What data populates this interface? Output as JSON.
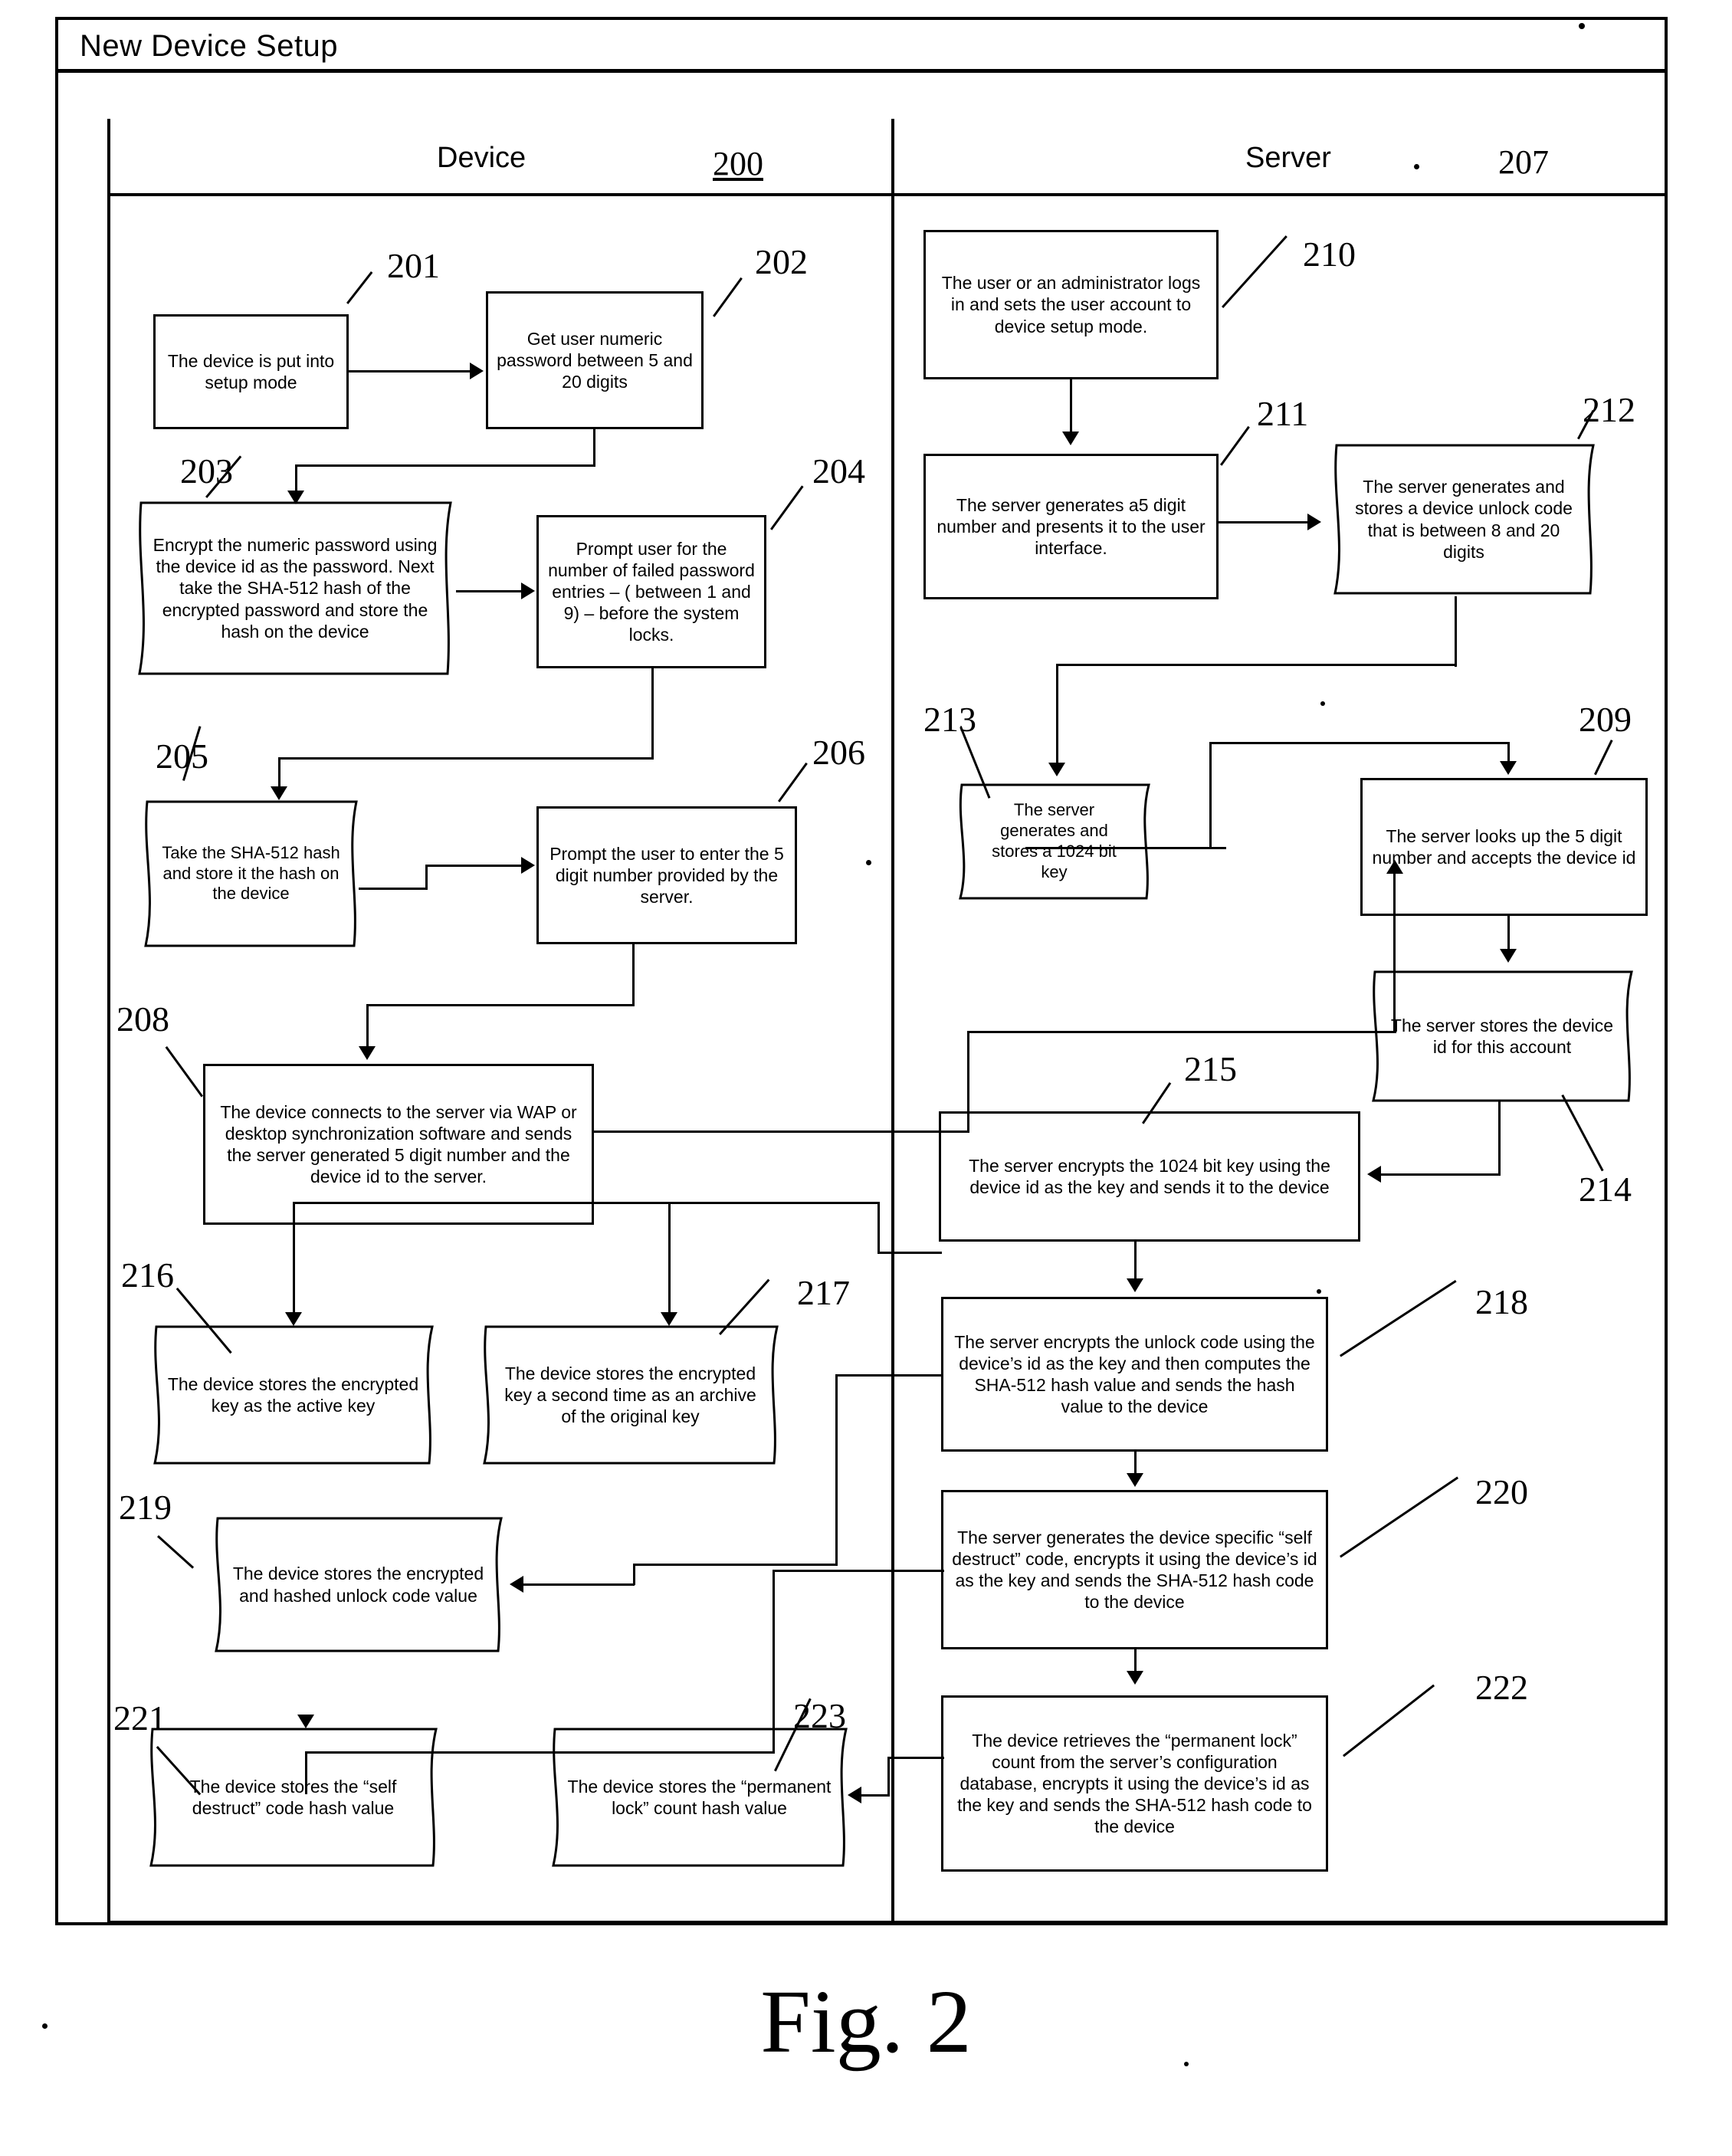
{
  "figure": {
    "caption": "Fig. 2",
    "title": "New Device Setup"
  },
  "lanes": [
    {
      "label": "Device",
      "ref": "200"
    },
    {
      "label": "Server",
      "ref": "207"
    }
  ],
  "nodes": [
    {
      "ref": "201",
      "lane": "Device",
      "shape": "process",
      "text": "The device is put into setup mode"
    },
    {
      "ref": "202",
      "lane": "Device",
      "shape": "process",
      "text": "Get user numeric password between 5 and 20 digits"
    },
    {
      "ref": "203",
      "lane": "Device",
      "shape": "document",
      "text": "Encrypt the numeric password using the device id as the password.  Next take the SHA-512 hash of the encrypted password and store the hash on the device"
    },
    {
      "ref": "204",
      "lane": "Device",
      "shape": "process",
      "text": "Prompt user for the number of failed password entries – ( between 1 and 9) – before the system locks."
    },
    {
      "ref": "205",
      "lane": "Device",
      "shape": "document",
      "text": "Take the SHA-512 hash and store it the hash on the device"
    },
    {
      "ref": "206",
      "lane": "Device",
      "shape": "process",
      "text": "Prompt the user to enter the 5 digit number provided by the server."
    },
    {
      "ref": "208",
      "lane": "Device",
      "shape": "process",
      "text": "The device connects to the server via WAP or desktop synchronization software and sends the server generated 5 digit number and the device id to the server."
    },
    {
      "ref": "216",
      "lane": "Device",
      "shape": "document",
      "text": "The device stores the encrypted key as the active key"
    },
    {
      "ref": "217",
      "lane": "Device",
      "shape": "document",
      "text": "The device stores the encrypted key a second time as an archive of the original key"
    },
    {
      "ref": "219",
      "lane": "Device",
      "shape": "document",
      "text": "The device stores the encrypted and hashed unlock code value"
    },
    {
      "ref": "221",
      "lane": "Device",
      "shape": "document",
      "text": "The device stores the “self destruct” code hash value"
    },
    {
      "ref": "223",
      "lane": "Device",
      "shape": "document",
      "text": "The device stores the “permanent lock” count hash value"
    },
    {
      "ref": "210",
      "lane": "Server",
      "shape": "process",
      "text": "The user or an administrator logs in and sets the user account to device setup mode."
    },
    {
      "ref": "211",
      "lane": "Server",
      "shape": "process",
      "text": "The server generates a5 digit number and presents it to the user interface."
    },
    {
      "ref": "212",
      "lane": "Server",
      "shape": "document",
      "text": "The server generates and stores a device unlock code that is between 8 and 20 digits"
    },
    {
      "ref": "213",
      "lane": "Server",
      "shape": "document",
      "text": "The server generates and stores a 1024 bit key"
    },
    {
      "ref": "209",
      "lane": "Server",
      "shape": "process",
      "text": "The server looks up the 5 digit number and accepts the device id"
    },
    {
      "ref": "214",
      "lane": "Server",
      "shape": "document",
      "text": "The server stores the device id for this account"
    },
    {
      "ref": "215",
      "lane": "Server",
      "shape": "process",
      "text": "The server encrypts the 1024 bit key using the device id as the key and sends it to the device"
    },
    {
      "ref": "218",
      "lane": "Server",
      "shape": "process",
      "text": "The server encrypts the unlock code using the device’s id as the key and then computes the SHA-512 hash value and sends the hash value to the device"
    },
    {
      "ref": "220",
      "lane": "Server",
      "shape": "process",
      "text": "The server generates the device specific “self destruct” code, encrypts it using the device’s id as the key and sends the SHA-512 hash code to the device"
    },
    {
      "ref": "222",
      "lane": "Server",
      "shape": "process",
      "text": "The device retrieves the “permanent lock” count from the server’s configuration database, encrypts it using the device’s id as the key and sends the SHA-512 hash code to the device"
    }
  ],
  "edges": [
    {
      "from": "201",
      "to": "202"
    },
    {
      "from": "202",
      "to": "203"
    },
    {
      "from": "203",
      "to": "204"
    },
    {
      "from": "204",
      "to": "205"
    },
    {
      "from": "205",
      "to": "206"
    },
    {
      "from": "206",
      "to": "208"
    },
    {
      "from": "208",
      "to": "209"
    },
    {
      "from": "210",
      "to": "211"
    },
    {
      "from": "211",
      "to": "212"
    },
    {
      "from": "212",
      "to": "213"
    },
    {
      "from": "213",
      "to": "209"
    },
    {
      "from": "209",
      "to": "214"
    },
    {
      "from": "214",
      "to": "215"
    },
    {
      "from": "215",
      "to": "216"
    },
    {
      "from": "215",
      "to": "217"
    },
    {
      "from": "215",
      "to": "218"
    },
    {
      "from": "218",
      "to": "219"
    },
    {
      "from": "218",
      "to": "220"
    },
    {
      "from": "220",
      "to": "221"
    },
    {
      "from": "220",
      "to": "222"
    },
    {
      "from": "222",
      "to": "223"
    }
  ],
  "colors": {
    "ink": "#000000",
    "paper": "#ffffff"
  }
}
